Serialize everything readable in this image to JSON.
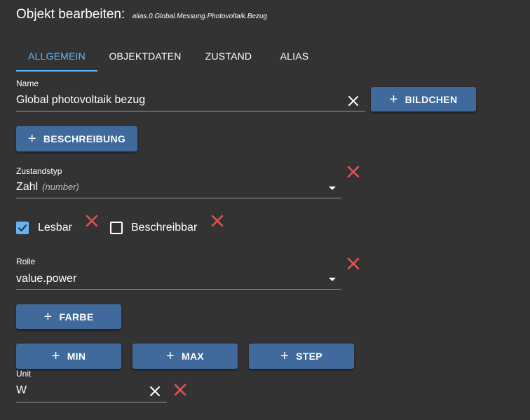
{
  "dialog": {
    "title": "Objekt bearbeiten:",
    "object_id": "alias.0.Global.Messung.Photovoltaik.Bezug"
  },
  "tabs": [
    {
      "label": "ALLGEMEIN",
      "active": true
    },
    {
      "label": "OBJEKTDATEN",
      "active": false
    },
    {
      "label": "ZUSTAND",
      "active": false
    },
    {
      "label": "ALIAS",
      "active": false
    }
  ],
  "name_field": {
    "label": "Name",
    "value": "Global photovoltaik bezug"
  },
  "buttons": {
    "icon_plus": "+",
    "bildchen": "BILDCHEN",
    "beschreibung": "BESCHREIBUNG",
    "farbe": "FARBE",
    "min": "MIN",
    "max": "MAX",
    "step": "STEP"
  },
  "state_type": {
    "label": "Zustandstyp",
    "value": "Zahl",
    "hint": "(number)"
  },
  "checkboxes": {
    "readable": {
      "label": "Lesbar",
      "checked": true
    },
    "writable": {
      "label": "Beschreibbar",
      "checked": false
    }
  },
  "role_field": {
    "label": "Rolle",
    "value": "value.power"
  },
  "unit_field": {
    "label": "Unit",
    "value": "W"
  },
  "icons": {
    "clear": "close-icon",
    "delete": "delete-x-icon",
    "dropdown": "chevron-down-icon",
    "check": "checkmark-icon"
  },
  "colors": {
    "background": "#333333",
    "accent": "#64b5f6",
    "button": "#3f6a9b",
    "delete": "#e05252"
  }
}
